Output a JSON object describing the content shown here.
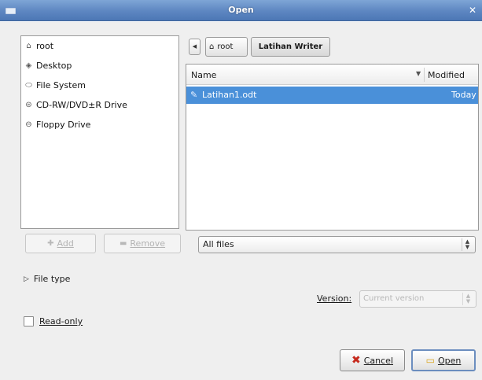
{
  "window": {
    "title": "Open"
  },
  "places": {
    "items": [
      {
        "label": "root",
        "icon": "home-folder-icon"
      },
      {
        "label": "Desktop",
        "icon": "desktop-icon"
      },
      {
        "label": "File System",
        "icon": "harddisk-icon"
      },
      {
        "label": "CD-RW/DVD±R Drive",
        "icon": "optical-drive-icon"
      },
      {
        "label": "Floppy Drive",
        "icon": "floppy-icon"
      }
    ],
    "add_button": "Add",
    "remove_button": "Remove"
  },
  "pathbar": {
    "root_label": "root",
    "current_label": "Latihan Writer"
  },
  "filelist": {
    "columns": [
      "Name",
      "Modified"
    ],
    "rows": [
      {
        "name": "Latihan1.odt",
        "modified": "Today",
        "selected": true
      }
    ]
  },
  "filter": {
    "selected": "All files"
  },
  "file_type": {
    "label": "File type"
  },
  "version": {
    "label": "Version:",
    "value": "Current version"
  },
  "readonly": {
    "label": "Read-only",
    "checked": false
  },
  "buttons": {
    "cancel": "Cancel",
    "open": "Open"
  },
  "colors": {
    "selection": "#4a90d9",
    "titlebar": "#5d86c1"
  }
}
